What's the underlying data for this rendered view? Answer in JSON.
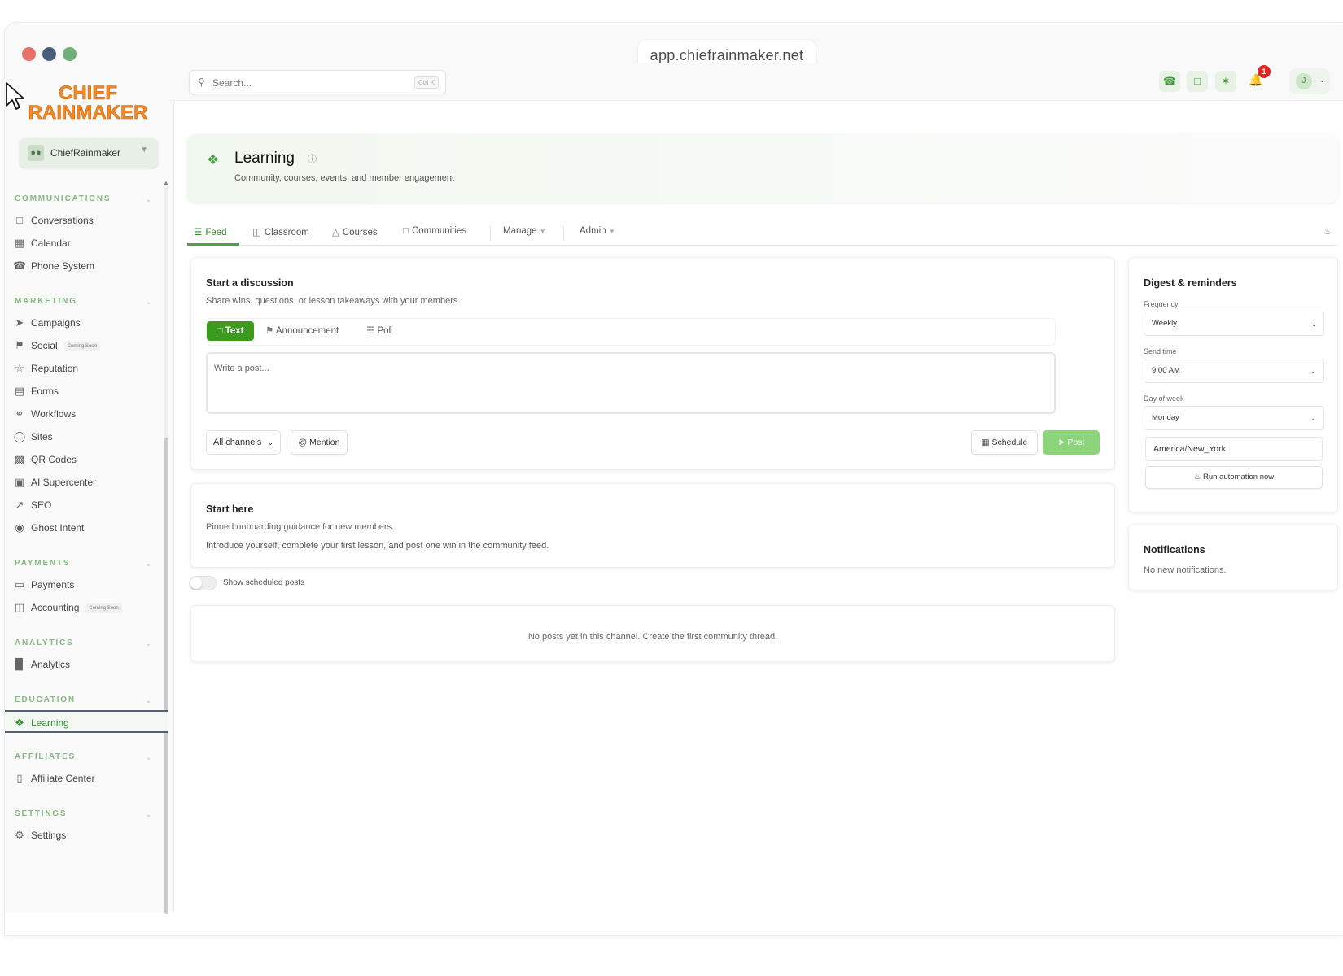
{
  "browser": {
    "url": "app.chiefrainmaker.net",
    "dots": [
      "#e8706a",
      "#4a5b7c",
      "#6fae77"
    ]
  },
  "brand": {
    "line1": "CHIEF",
    "line2": "RAINMAKER",
    "color": "#f5891f"
  },
  "account": {
    "name": "ChiefRainmaker"
  },
  "sidebar": {
    "sections": [
      {
        "title": "COMMUNICATIONS",
        "items": [
          {
            "label": "Conversations",
            "icon": "chat-square-icon"
          },
          {
            "label": "Calendar",
            "icon": "calendar-icon"
          },
          {
            "label": "Phone System",
            "icon": "phone-icon"
          }
        ]
      },
      {
        "title": "MARKETING",
        "items": [
          {
            "label": "Campaigns",
            "icon": "send-icon"
          },
          {
            "label": "Social",
            "icon": "megaphone-icon",
            "tag": "Coming Soon"
          },
          {
            "label": "Reputation",
            "icon": "star-icon"
          },
          {
            "label": "Forms",
            "icon": "document-icon"
          },
          {
            "label": "Workflows",
            "icon": "workflow-icon"
          },
          {
            "label": "Sites",
            "icon": "globe-icon"
          },
          {
            "label": "QR Codes",
            "icon": "qr-code-icon"
          },
          {
            "label": "AI Supercenter",
            "icon": "robot-icon"
          },
          {
            "label": "SEO",
            "icon": "trend-icon"
          },
          {
            "label": "Ghost Intent",
            "icon": "eye-icon"
          }
        ]
      },
      {
        "title": "PAYMENTS",
        "items": [
          {
            "label": "Payments",
            "icon": "credit-card-icon"
          },
          {
            "label": "Accounting",
            "icon": "book-open-icon",
            "tag": "Coming Soon"
          }
        ]
      },
      {
        "title": "ANALYTICS",
        "items": [
          {
            "label": "Analytics",
            "icon": "bar-chart-icon"
          }
        ]
      },
      {
        "title": "EDUCATION",
        "items": [
          {
            "label": "Learning",
            "icon": "book-icon",
            "active": true
          }
        ]
      },
      {
        "title": "AFFILIATES",
        "items": [
          {
            "label": "Affiliate Center",
            "icon": "gift-icon"
          }
        ]
      },
      {
        "title": "SETTINGS",
        "items": [
          {
            "label": "Settings",
            "icon": "gear-icon"
          }
        ]
      }
    ]
  },
  "topbar": {
    "search_placeholder": "Search...",
    "shortcut": "Ctrl K",
    "notification_count": "1",
    "user_initial": "J"
  },
  "page": {
    "title": "Learning",
    "subtitle": "Community, courses, events, and member engagement"
  },
  "tabs": [
    {
      "label": "Feed",
      "icon": "grid-list-icon",
      "active": true
    },
    {
      "label": "Classroom",
      "icon": "book-icon"
    },
    {
      "label": "Courses",
      "icon": "graduation-cap-icon"
    },
    {
      "label": "Communities",
      "icon": "chat-square-icon"
    },
    {
      "label": "Manage",
      "dropdown": true
    },
    {
      "label": "Admin",
      "dropdown": true
    }
  ],
  "discussion": {
    "title": "Start a discussion",
    "subtitle": "Share wins, questions, or lesson takeaways with your members.",
    "types": [
      {
        "label": "Text",
        "active": true
      },
      {
        "label": "Announcement"
      },
      {
        "label": "Poll"
      }
    ],
    "placeholder": "Write a post...",
    "channel": "All channels",
    "mention": "Mention",
    "schedule": "Schedule",
    "post": "Post"
  },
  "start_here": {
    "title": "Start here",
    "subtitle": "Pinned onboarding guidance for new members.",
    "body": "Introduce yourself, complete your first lesson, and post one win in the community feed."
  },
  "toggle_label": "Show scheduled posts",
  "empty_message": "No posts yet in this channel. Create the first community thread.",
  "digest": {
    "title": "Digest & reminders",
    "frequency_label": "Frequency",
    "frequency": "Weekly",
    "send_time_label": "Send time",
    "send_time": "9:00 AM",
    "day_label": "Day of week",
    "day": "Monday",
    "timezone": "America/New_York",
    "run_button": "Run automation now"
  },
  "notifications": {
    "title": "Notifications",
    "message": "No new notifications."
  }
}
